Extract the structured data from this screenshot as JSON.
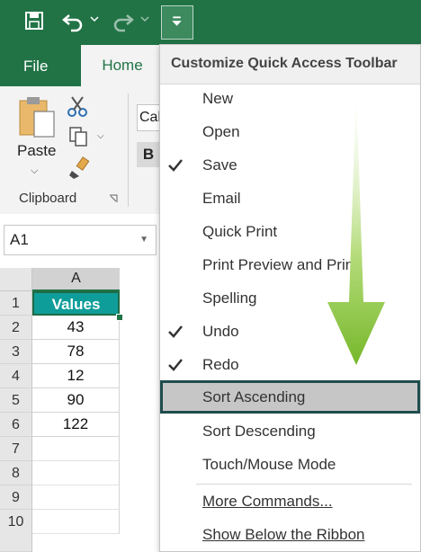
{
  "qat": {
    "save_icon": "save-icon",
    "undo_icon": "undo-icon",
    "redo_icon": "redo-icon",
    "customize_icon": "customize-qat-icon"
  },
  "tabs": {
    "file": "File",
    "home": "Home"
  },
  "clipboard": {
    "paste_label": "Paste",
    "group_label": "Clipboard"
  },
  "font": {
    "name_partial": "Cal",
    "bold_label": "B"
  },
  "name_box": {
    "value": "A1"
  },
  "sheet": {
    "column_header": "A",
    "row_numbers": [
      "1",
      "2",
      "3",
      "4",
      "5",
      "6",
      "7",
      "8",
      "9",
      "10"
    ],
    "cells": [
      "Values",
      "43",
      "78",
      "12",
      "90",
      "122",
      "",
      "",
      "",
      ""
    ]
  },
  "menu": {
    "title": "Customize Quick Access Toolbar",
    "items": [
      {
        "label": "New",
        "checked": false
      },
      {
        "label": "Open",
        "checked": false
      },
      {
        "label": "Save",
        "checked": true
      },
      {
        "label": "Email",
        "checked": false
      },
      {
        "label": "Quick Print",
        "checked": false
      },
      {
        "label": "Print Preview and Print",
        "checked": false
      },
      {
        "label": "Spelling",
        "checked": false
      },
      {
        "label": "Undo",
        "checked": true
      },
      {
        "label": "Redo",
        "checked": true
      },
      {
        "label": "Sort Ascending",
        "checked": false
      },
      {
        "label": "Sort Descending",
        "checked": false
      },
      {
        "label": "Touch/Mouse Mode",
        "checked": false
      }
    ],
    "more_commands": "More Commands...",
    "show_below": "Show Below the Ribbon"
  },
  "colors": {
    "excel_green": "#217346",
    "header_teal": "#0f9d9a",
    "highlight_border": "#1f4d4d",
    "arrow_green": "#8cc63f"
  }
}
